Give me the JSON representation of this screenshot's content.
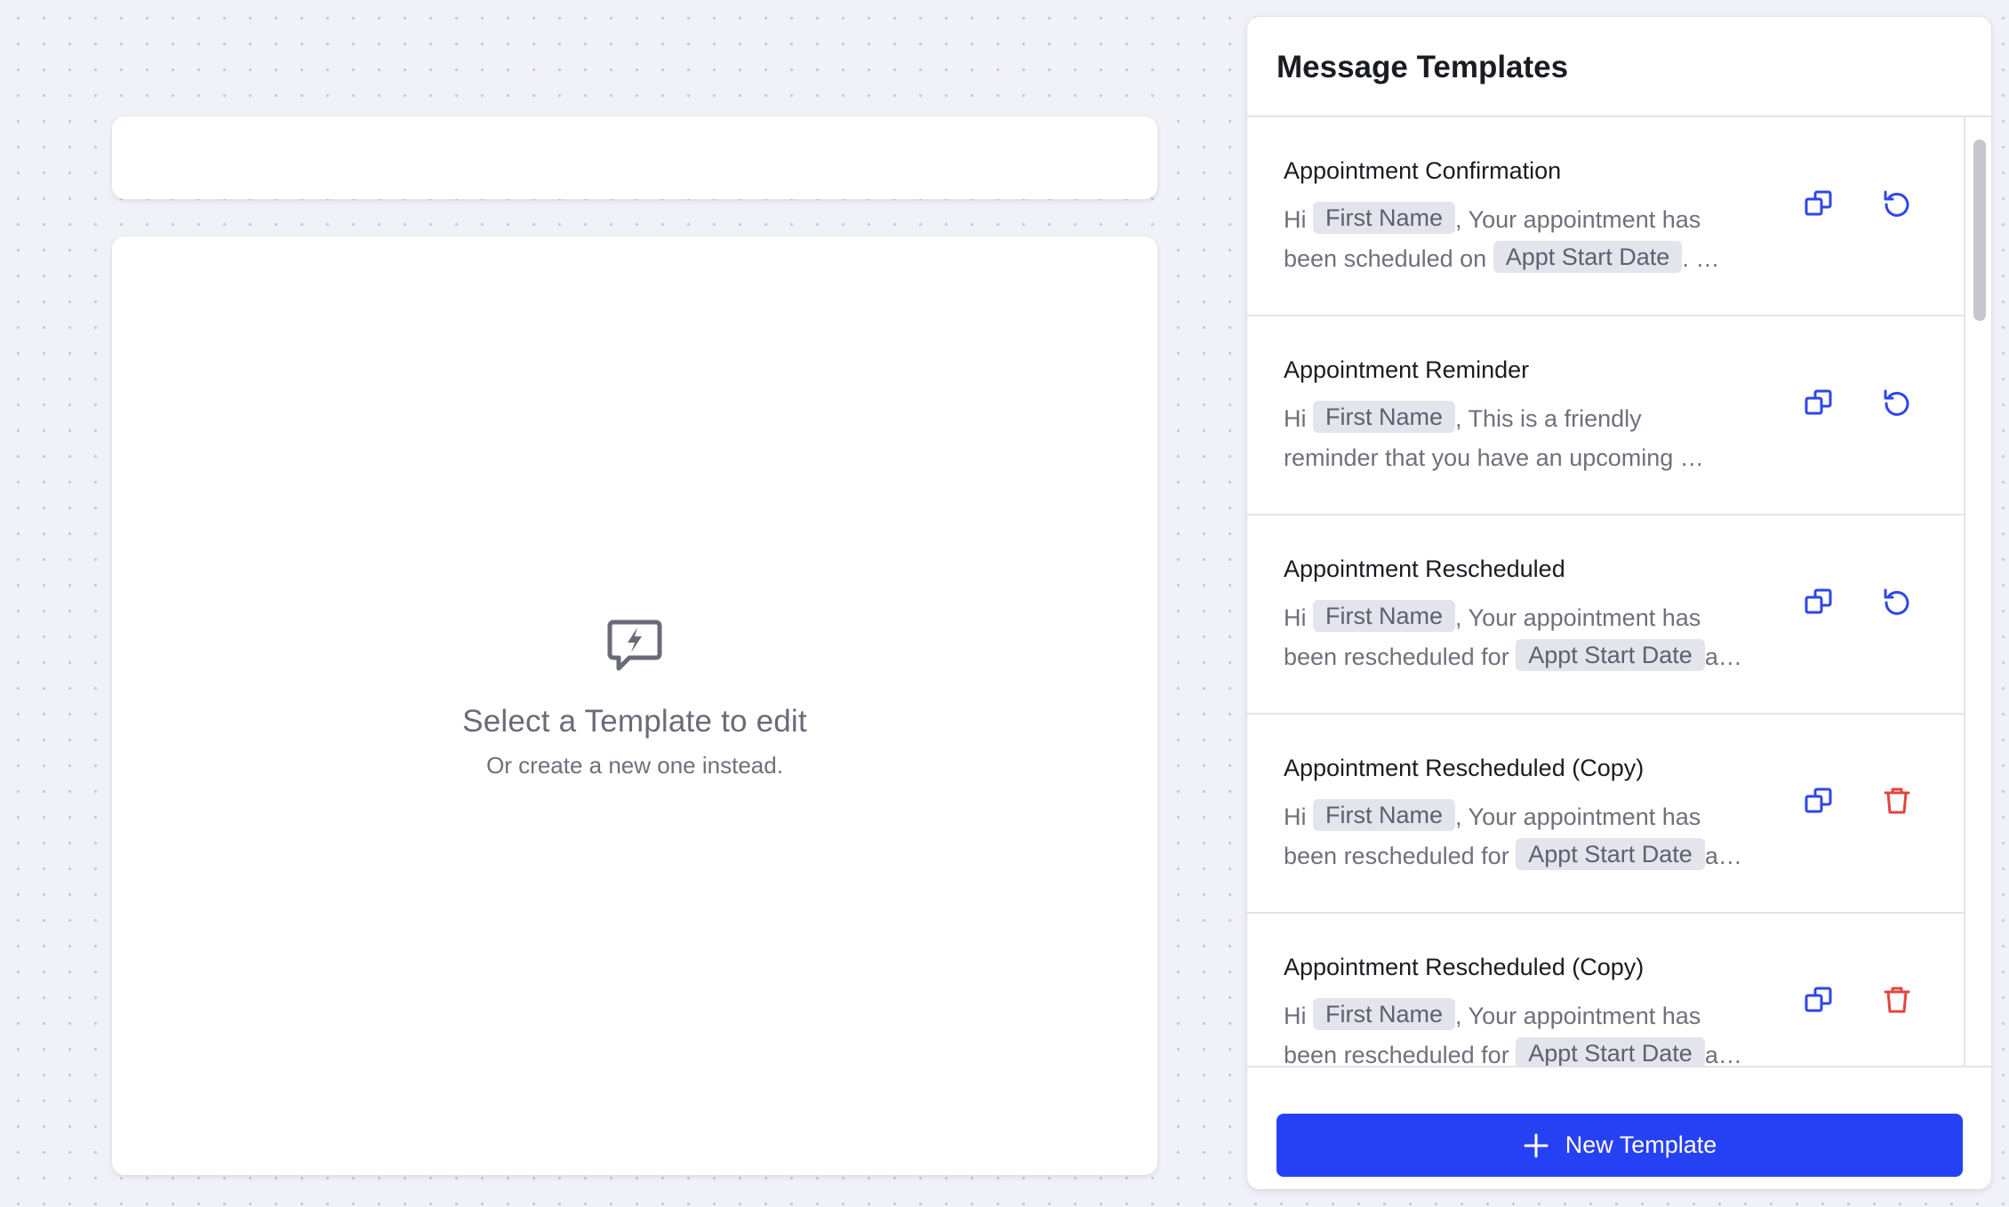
{
  "editor": {
    "empty_title": "Select a Template to edit",
    "empty_subtitle": "Or create a new one instead."
  },
  "panel": {
    "title": "Message Templates",
    "new_button_label": "New Template",
    "templates": [
      {
        "name": "Appointment Confirmation",
        "line1": [
          "Hi",
          "First Name",
          ",  Your appointment has"
        ],
        "line2": [
          "been scheduled on",
          "Appt Start Date",
          ".  …"
        ],
        "action": "reset"
      },
      {
        "name": "Appointment Reminder",
        "line1": [
          "Hi",
          "First Name",
          ",  This is a friendly"
        ],
        "line2": [
          "reminder that you have an upcoming …",
          "",
          ""
        ],
        "action": "reset"
      },
      {
        "name": "Appointment Rescheduled",
        "line1": [
          "Hi",
          "First Name",
          ",  Your appointment has"
        ],
        "line2": [
          "been rescheduled for",
          "Appt Start Date",
          "a…"
        ],
        "action": "reset"
      },
      {
        "name": "Appointment Rescheduled (Copy)",
        "line1": [
          "Hi",
          "First Name",
          ",  Your appointment has"
        ],
        "line2": [
          "been rescheduled for",
          "Appt Start Date",
          "a…"
        ],
        "action": "delete"
      },
      {
        "name": "Appointment Rescheduled (Copy)",
        "line1": [
          "Hi",
          "First Name",
          ",  Your appointment has"
        ],
        "line2": [
          "been rescheduled for",
          "Appt Start Date",
          "a…"
        ],
        "action": "delete"
      }
    ]
  },
  "icons": {
    "empty": "chat-bolt-icon",
    "copy": "copy-icon",
    "reset": "reset-icon",
    "delete": "trash-icon",
    "plus": "plus-icon"
  },
  "colors": {
    "accent": "#2641f4",
    "icon_blue": "#2f46e8",
    "delete_red": "#e0473e",
    "chip_bg": "#e4e4ec"
  }
}
